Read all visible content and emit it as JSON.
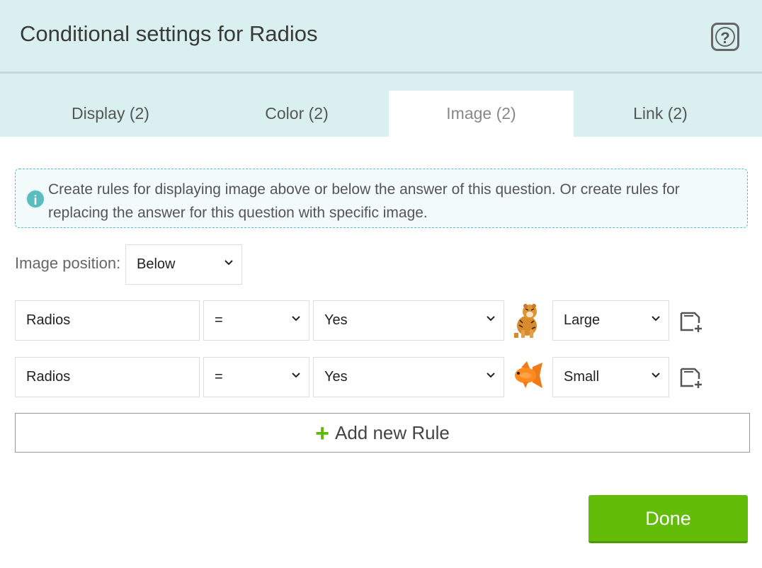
{
  "dialog": {
    "title": "Conditional settings for Radios",
    "help_icon": "question-icon"
  },
  "tabs": [
    {
      "label": "Display (2)",
      "active": false
    },
    {
      "label": "Color (2)",
      "active": false
    },
    {
      "label": "Image (2)",
      "active": true
    },
    {
      "label": "Link (2)",
      "active": false
    }
  ],
  "info": {
    "icon": "info-icon",
    "text": "Create rules for displaying image above or below the answer of this question. Or create rules for replacing the answer for this question with specific image."
  },
  "image_position": {
    "label": "Image position:",
    "value": "Below"
  },
  "rules": [
    {
      "field": "Radios",
      "operator": "=",
      "value": "Yes",
      "image": "tiger-image",
      "size": "Large"
    },
    {
      "field": "Radios",
      "operator": "=",
      "value": "Yes",
      "image": "goldfish-image",
      "size": "Small"
    }
  ],
  "add_rule_label": "Add new Rule",
  "done_label": "Done",
  "colors": {
    "header_bg": "#daf0f0",
    "accent_green": "#62bc08",
    "info_border": "#5bbcc8"
  }
}
